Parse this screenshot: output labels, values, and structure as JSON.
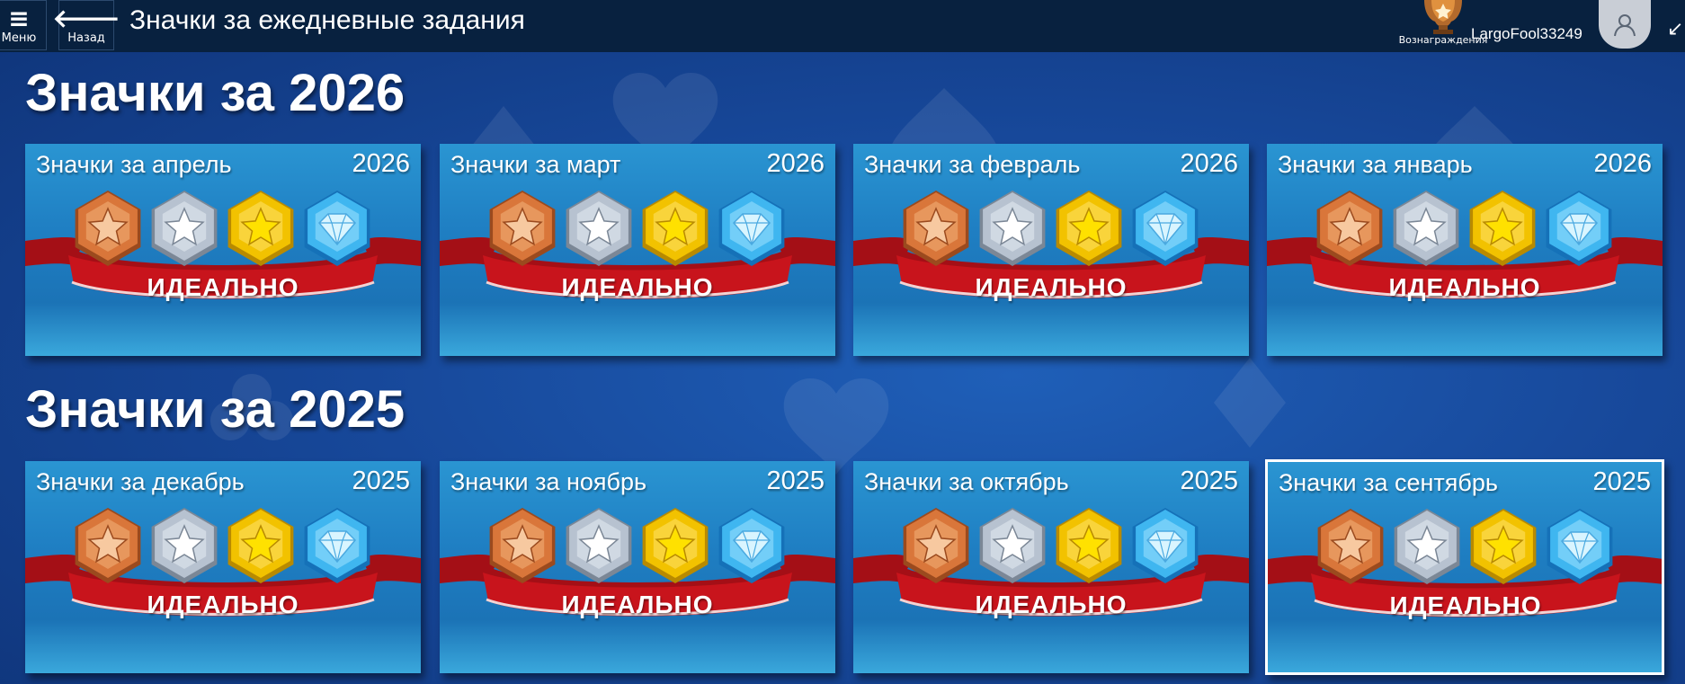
{
  "header": {
    "menu_label": "Меню",
    "back_label": "Назад",
    "title": "Значки за ежедневные задания",
    "rewards_label": "Вознаграждения",
    "username": "LargoFool33249"
  },
  "sections": [
    {
      "title": "Значки за 2026",
      "cards": [
        {
          "title": "Значки за апрель",
          "year": "2026",
          "ribbon": "ИДЕАЛЬНО"
        },
        {
          "title": "Значки за март",
          "year": "2026",
          "ribbon": "ИДЕАЛЬНО"
        },
        {
          "title": "Значки за февраль",
          "year": "2026",
          "ribbon": "ИДЕАЛЬНО"
        },
        {
          "title": "Значки за январь",
          "year": "2026",
          "ribbon": "ИДЕАЛЬНО"
        }
      ]
    },
    {
      "title": "Значки за 2025",
      "cards": [
        {
          "title": "Значки за декабрь",
          "year": "2025",
          "ribbon": "ИДЕАЛЬНО"
        },
        {
          "title": "Значки за ноябрь",
          "year": "2025",
          "ribbon": "ИДЕАЛЬНО"
        },
        {
          "title": "Значки за октябрь",
          "year": "2025",
          "ribbon": "ИДЕАЛЬНО"
        },
        {
          "title": "Значки за сентябрь",
          "year": "2025",
          "ribbon": "ИДЕАЛЬНО",
          "selected": true
        }
      ]
    }
  ],
  "icons": {
    "menu": "hamburger-icon",
    "back": "arrow-left-icon",
    "rewards": "trophy-icon",
    "avatar": "user-avatar-icon",
    "collapse": "collapse-arrow-icon",
    "badges": [
      "bronze-star-badge-icon",
      "silver-star-badge-icon",
      "gold-star-badge-icon",
      "diamond-badge-icon"
    ]
  },
  "colors": {
    "topbar": "#08213f",
    "background": "#17489a",
    "card": "#1f7fc3",
    "ribbon": "#c8141c",
    "bronze": "#d9763a",
    "silver": "#b7c2d0",
    "gold": "#f2c200",
    "diamond": "#3fb6f0"
  }
}
